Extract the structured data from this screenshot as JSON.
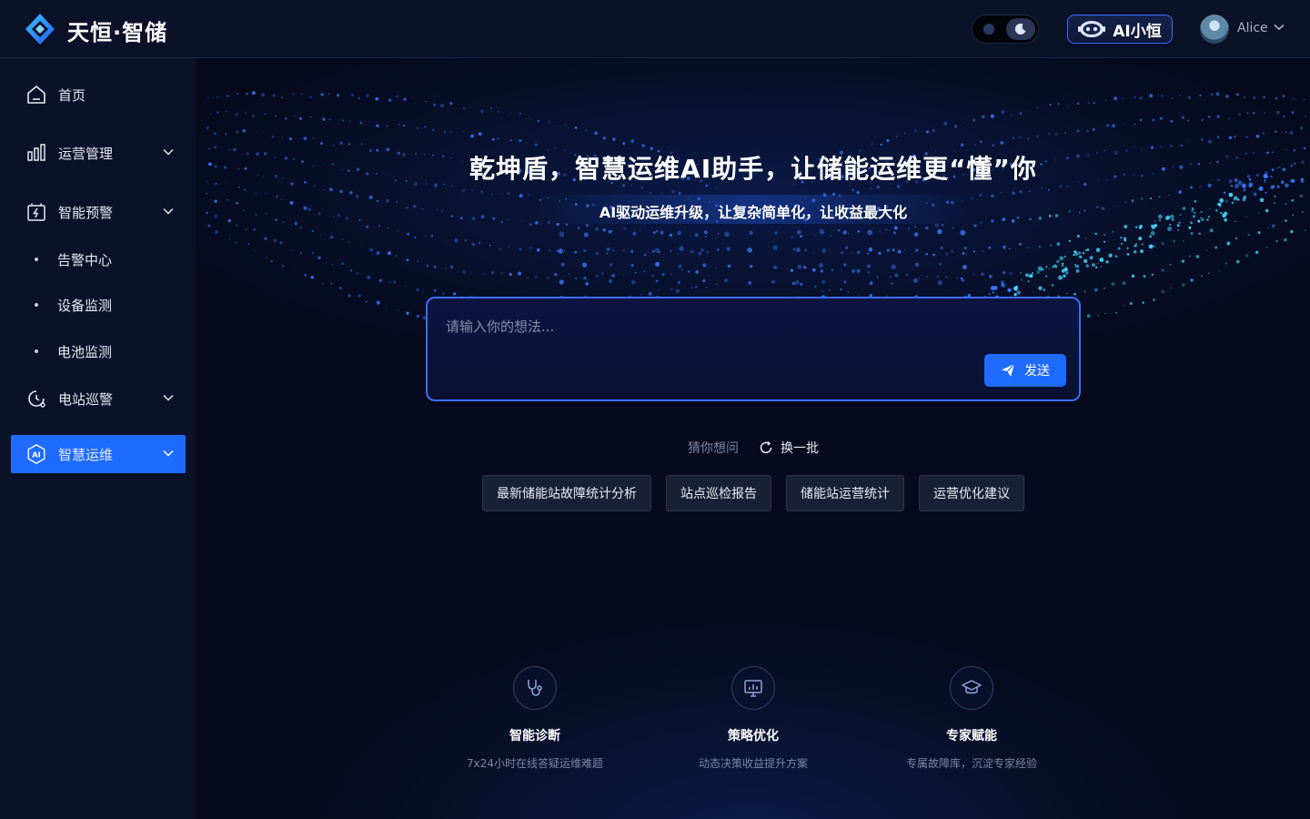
{
  "header": {
    "brand": "天恒·智储",
    "ai_label": "AI小恒",
    "user": "Alice"
  },
  "sidebar": {
    "items": [
      {
        "label": "首页",
        "icon": "home-icon"
      },
      {
        "label": "运营管理",
        "icon": "bar-chart-icon"
      },
      {
        "label": "智能预警",
        "icon": "battery-alert-icon"
      },
      {
        "label": "电站巡警",
        "icon": "patrol-icon"
      },
      {
        "label": "智慧运维",
        "icon": "ai-ops-icon"
      }
    ],
    "subitems": [
      "告警中心",
      "设备监测",
      "电池监测"
    ]
  },
  "main": {
    "title": "乾坤盾，智慧运维AI助手，让储能运维更“懂”你",
    "subtitle": "AI驱动运维升级，让复杂简单化，让收益最大化",
    "input_placeholder": "请输入你的想法...",
    "send_label": "发送",
    "guess_label": "猜你想问",
    "refresh_label": "换一批",
    "chips": [
      "最新储能站故障统计分析",
      "站点巡检报告",
      "储能站运营统计",
      "运营优化建议"
    ],
    "features": [
      {
        "title": "智能诊断",
        "desc": "7x24小时在线答疑运维难题",
        "icon": "stethoscope-icon"
      },
      {
        "title": "策略优化",
        "desc": "动态决策收益提升方案",
        "icon": "monitor-chart-icon"
      },
      {
        "title": "专家赋能",
        "desc": "专属故障库，沉淀专家经验",
        "icon": "graduation-cap-icon"
      }
    ]
  },
  "colors": {
    "accent": "#1f6bff",
    "sidebar_bg": "#0b1126",
    "main_bg": "#060a1c",
    "chip_bg": "#1a2033"
  }
}
